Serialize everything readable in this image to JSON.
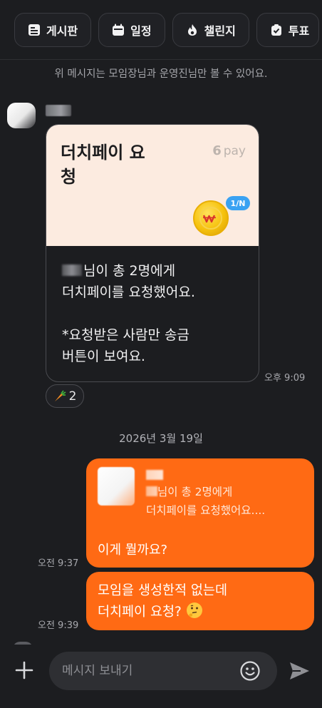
{
  "tabs": [
    {
      "label": "게시판",
      "icon": "board-icon"
    },
    {
      "label": "일정",
      "icon": "calendar-icon"
    },
    {
      "label": "챌린지",
      "icon": "flame-icon"
    },
    {
      "label": "투표",
      "icon": "vote-icon"
    }
  ],
  "notice": "위 메시지는 모임장님과 운영진님만 볼 수 있어요.",
  "card": {
    "title": "더치페이 요청",
    "pay_logo": "pay",
    "badge": "1/N",
    "body_line1": "님이 총 2명에게",
    "body_line2": "더치페이를 요청했어요.",
    "body_line3": "*요청받은 사람만 송금",
    "body_line4": "버튼이 보여요."
  },
  "card_time": "오후 9:09",
  "reaction_count": "2",
  "date_separator": "2026년 3월 19일",
  "outgoing": [
    {
      "quote_line1": "님이 총 2명에게",
      "quote_line2": "더치페이를 요청했어요....",
      "text": "이게 뭘까요?",
      "time": "오전 9:37"
    },
    {
      "line1": "모임을 생성한적 없는데",
      "line2": "더치페이 요청?",
      "time": "오전 9:39"
    }
  ],
  "input": {
    "placeholder": "메시지 보내기"
  },
  "colors": {
    "accent": "#ff6a14",
    "background": "#1c1d20",
    "card_header": "#fcebe0",
    "badge": "#3aa2f2"
  }
}
